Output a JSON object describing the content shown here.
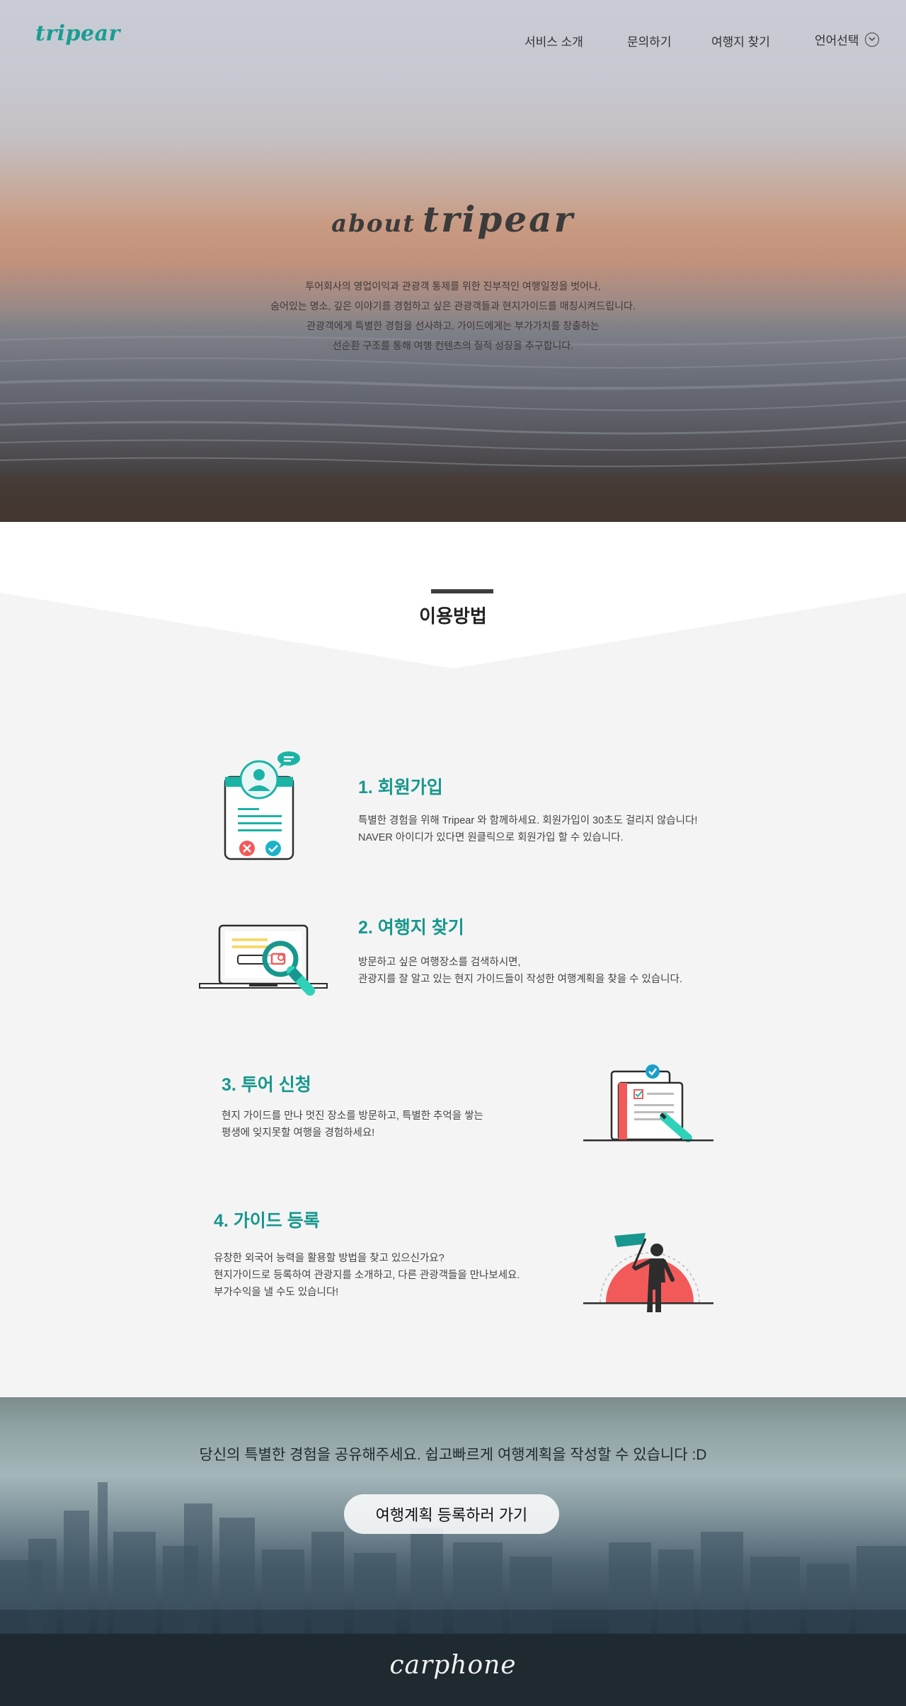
{
  "header": {
    "logo": "tripear",
    "nav": [
      "서비스 소개",
      "문의하기",
      "여행지 찾기"
    ],
    "language_label": "언어선택"
  },
  "hero": {
    "title_prefix": "about",
    "title_main": "tripear",
    "description": [
      "투어회사의 영업이익과 관광객 통제를 위한 진부적인 여행일정을 벗어나,",
      "숨어있는 명소, 깊은 이야기를 경험하고 싶은 관광객들과 현지가이드를 매칭시켜드립니다.",
      "관광객에게 특별한 경험을 선사하고, 가이드에게는 부가가치를 창출하는",
      "선순환 구조를 통해 여행 컨텐츠의 질적 성장을 추구합니다."
    ]
  },
  "howto": {
    "section_title": "이용방법",
    "steps": [
      {
        "title": "1. 회원가입",
        "lines": [
          "특별한 경험을 위해 Tripear 와 함께하세요. 회원가입이 30초도 걸리지 않습니다!",
          "NAVER 아이디가 있다면 원클릭으로 회원가입 할 수 있습니다."
        ]
      },
      {
        "title": "2. 여행지 찾기",
        "lines": [
          "방문하고 싶은 여행장소를 검색하시면,",
          "관광지를 잘 알고 있는 현지 가이드들이 작성한 여행계획을 찾을 수 있습니다."
        ]
      },
      {
        "title": "3. 투어 신청",
        "lines": [
          "현지 가이드를 만나 멋진 장소를 방문하고, 특별한 추억을 쌓는",
          "평생에 잊지못할 여행을 경험하세요!"
        ]
      },
      {
        "title": "4. 가이드 등록",
        "lines": [
          "유창한 외국어 능력을 활용할 방법을 찾고 있으신가요?",
          "현지가이드로 등록하여 관광지를 소개하고, 다른 관광객들을 만나보세요.",
          "부가수익을 낼 수도 있습니다!"
        ]
      }
    ]
  },
  "cta": {
    "text": "당신의 특별한 경험을 공유해주세요. 쉽고빠르게 여행계획을 작성할 수 있습니다 :D",
    "button": "여행계획 등록하러 가기"
  },
  "footer": {
    "logo": "carphone"
  },
  "colors": {
    "brand": "#17978d",
    "accent_red": "#f25a5a",
    "footer_bg": "#1e2a30"
  },
  "icons": [
    "chevron-down-icon",
    "signup-form-icon",
    "laptop-search-icon",
    "tour-document-icon",
    "guide-flag-icon"
  ]
}
